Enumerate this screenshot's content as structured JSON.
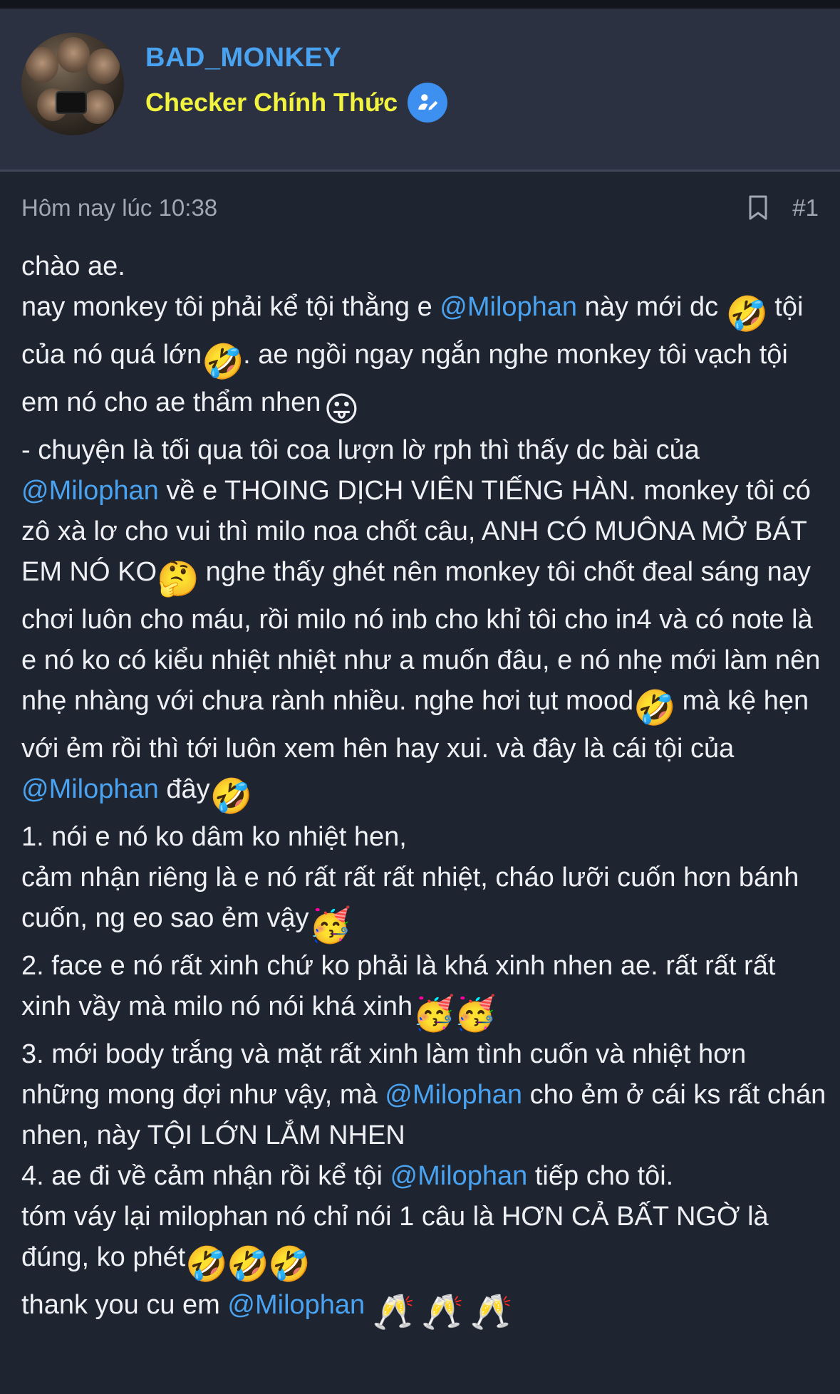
{
  "header": {
    "username": "BAD_MONKEY",
    "role": "Checker Chính Thức",
    "verified_icon": "verified-user-icon",
    "avatar_icon": "monkeys-avatar"
  },
  "post": {
    "timestamp": "Hôm nay lúc 10:38",
    "number": "#1",
    "bookmark_icon": "bookmark-icon"
  },
  "body": {
    "l1": "chào ae.",
    "l2a": "nay monkey tôi phải kể tội thằng e ",
    "mention": "@Milophan",
    "l2b": " này mới dc",
    "l3a": " tội của nó quá lớn",
    "l3b": ". ae ngồi ngay ngắn nghe monkey tôi vạch tội em nó cho ae thẩm nhen",
    "l4a": "- chuyện là tối qua tôi coa lượn lờ rph thì thấy dc bài của ",
    "l4b": " về e THOING DỊCH VIÊN TIẾNG HÀN. monkey tôi có zô xà lơ cho vui thì milo noa chốt câu, ANH CÓ MUÔNA MỞ BÁT EM NÓ KO",
    "l4c": " nghe thấy ghét nên monkey tôi chốt đeal sáng nay chơi luôn cho máu, rồi milo nó inb cho khỉ tôi cho in4 và có note là e nó ko có kiểu nhiệt nhiệt như a muốn đâu, e nó nhẹ mới làm nên nhẹ nhàng với chưa rành nhiều. nghe hơi tụt mood",
    "l4d": " mà kệ hẹn với ẻm rồi thì tới luôn xem hên hay xui. và đây là cái tội của ",
    "l4e": "đây",
    "l5": "1. nói e nó ko dâm ko nhiệt hen,",
    "l6": "cảm nhận riêng là e nó rất rất rất nhiệt, cháo lưỡi cuốn hơn bánh cuốn, ng eo sao ẻm vậy",
    "l7": "2. face e nó rất xinh chứ ko phải là khá xinh nhen ae. rất rất rất xinh vầy mà milo nó nói khá xinh",
    "l8a": "3. mới body trắng và mặt rất xinh làm tình cuốn và nhiệt hơn những mong đợi như vậy, mà ",
    "l8b": " cho ẻm ở cái ks rất chán nhen, này TỘI LỚN LẮM NHEN",
    "l9a": "4. ae đi về cảm nhận rồi kể tội ",
    "l9b": " tiếp cho tôi.",
    "l10": "tóm váy lại milophan nó chỉ nói 1 câu là HƠN CẢ BẤT NGỜ là đúng, ko phét",
    "l11": "thank you cu em ",
    "emoji_rofl": "🤣",
    "emoji_tongue": "😛",
    "emoji_thinking": "🤔",
    "emoji_party": "🥳",
    "emoji_cheers": "🥂"
  },
  "colors": {
    "background": "#1f2431",
    "header": "#2b3141",
    "username": "#4aa3f0",
    "role": "#f2f33f",
    "mention": "#4aa3f0",
    "text": "#eef0f4",
    "meta": "#a2a7b4"
  }
}
